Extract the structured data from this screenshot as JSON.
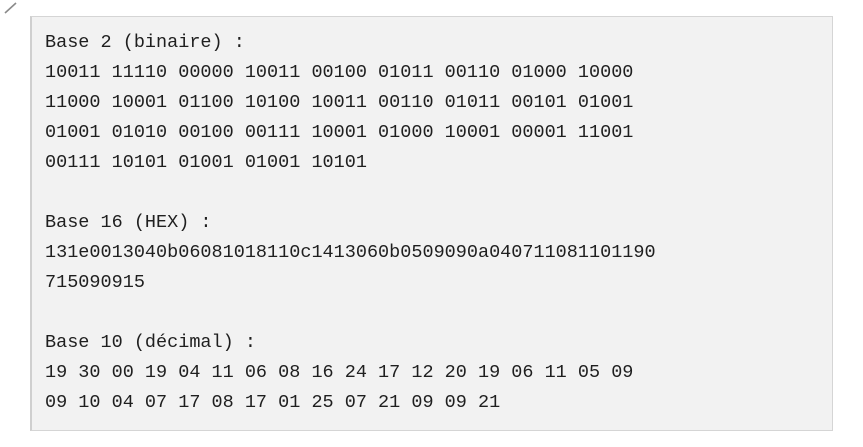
{
  "code_block": {
    "sections": [
      {
        "heading": "Base 2 (binaire) :",
        "lines": [
          "10011 11110 00000 10011 00100 01011 00110 01000 10000",
          "11000 10001 01100 10100 10011 00110 01011 00101 01001",
          "01001 01010 00100 00111 10001 01000 10001 00001 11001",
          "00111 10101 01001 01001 10101"
        ]
      },
      {
        "heading": "Base 16 (HEX) :",
        "lines": [
          "131e0013040b06081018110c1413060b0509090a040711081101190",
          "715090915"
        ]
      },
      {
        "heading": "Base 10 (décimal) :",
        "lines": [
          "19 30 00 19 04 11 06 08 16 24 17 12 20 19 06 11 05 09",
          "09 10 04 07 17 08 17 01 25 07 21 09 09 21"
        ]
      }
    ]
  }
}
